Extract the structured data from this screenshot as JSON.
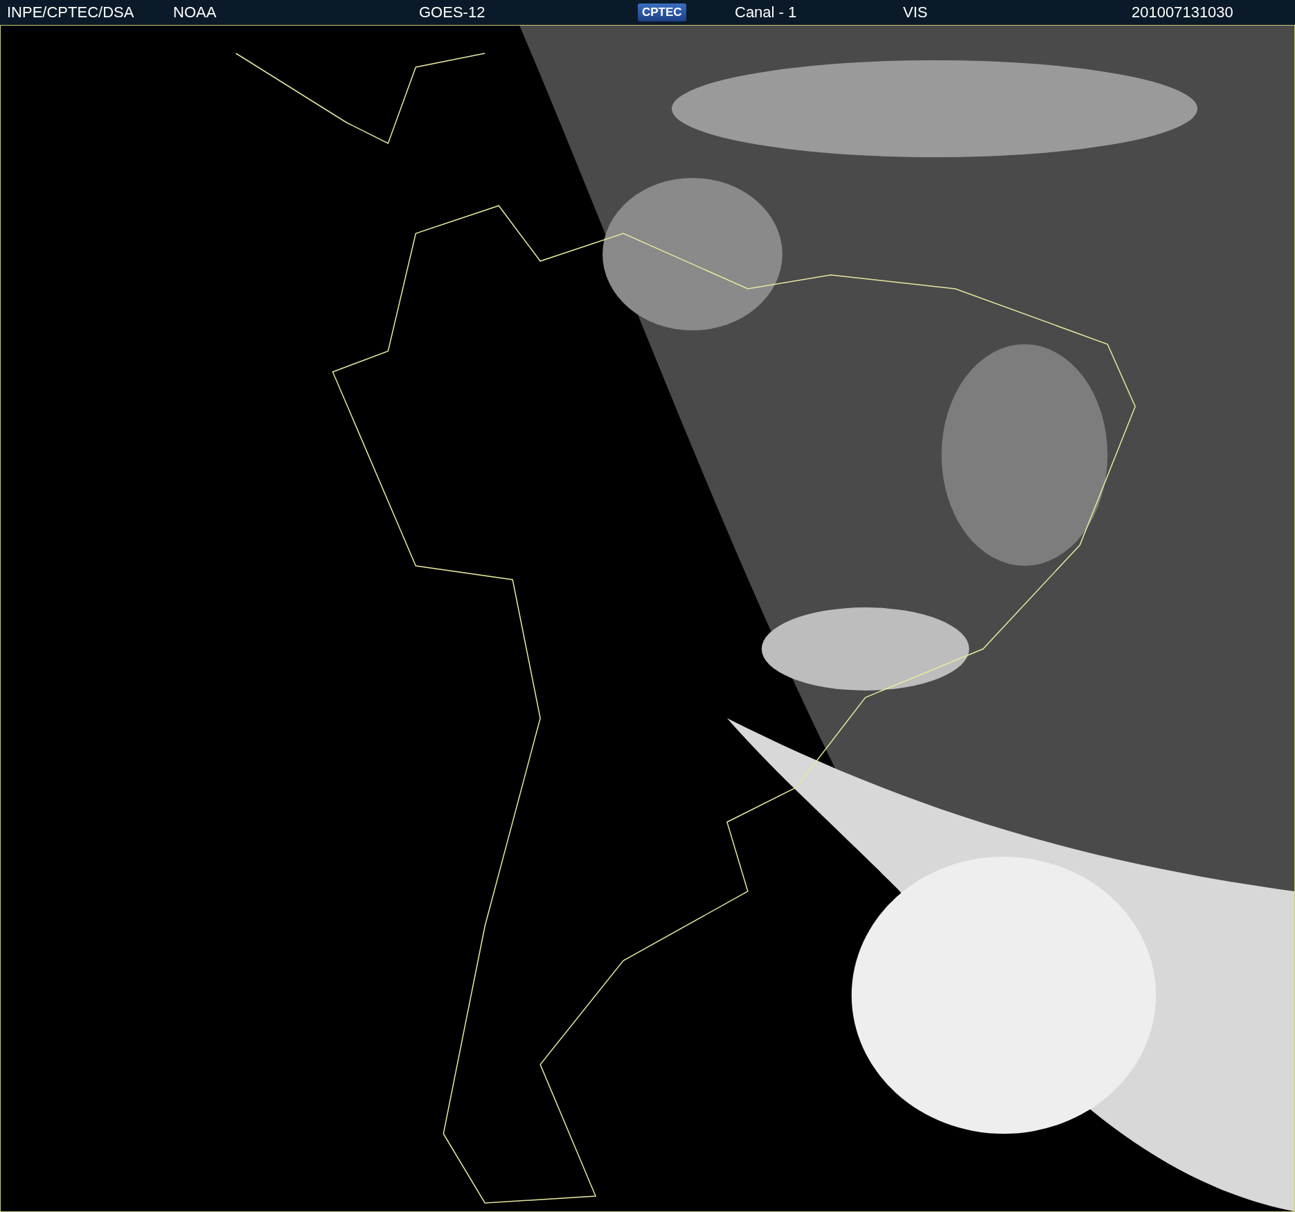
{
  "header": {
    "source": "INPE/CPTEC/DSA",
    "agency": "NOAA",
    "satellite": "GOES-12",
    "logo": "CPTEC",
    "channel": "Canal - 1",
    "band": "VIS",
    "timestamp": "201007131030"
  }
}
